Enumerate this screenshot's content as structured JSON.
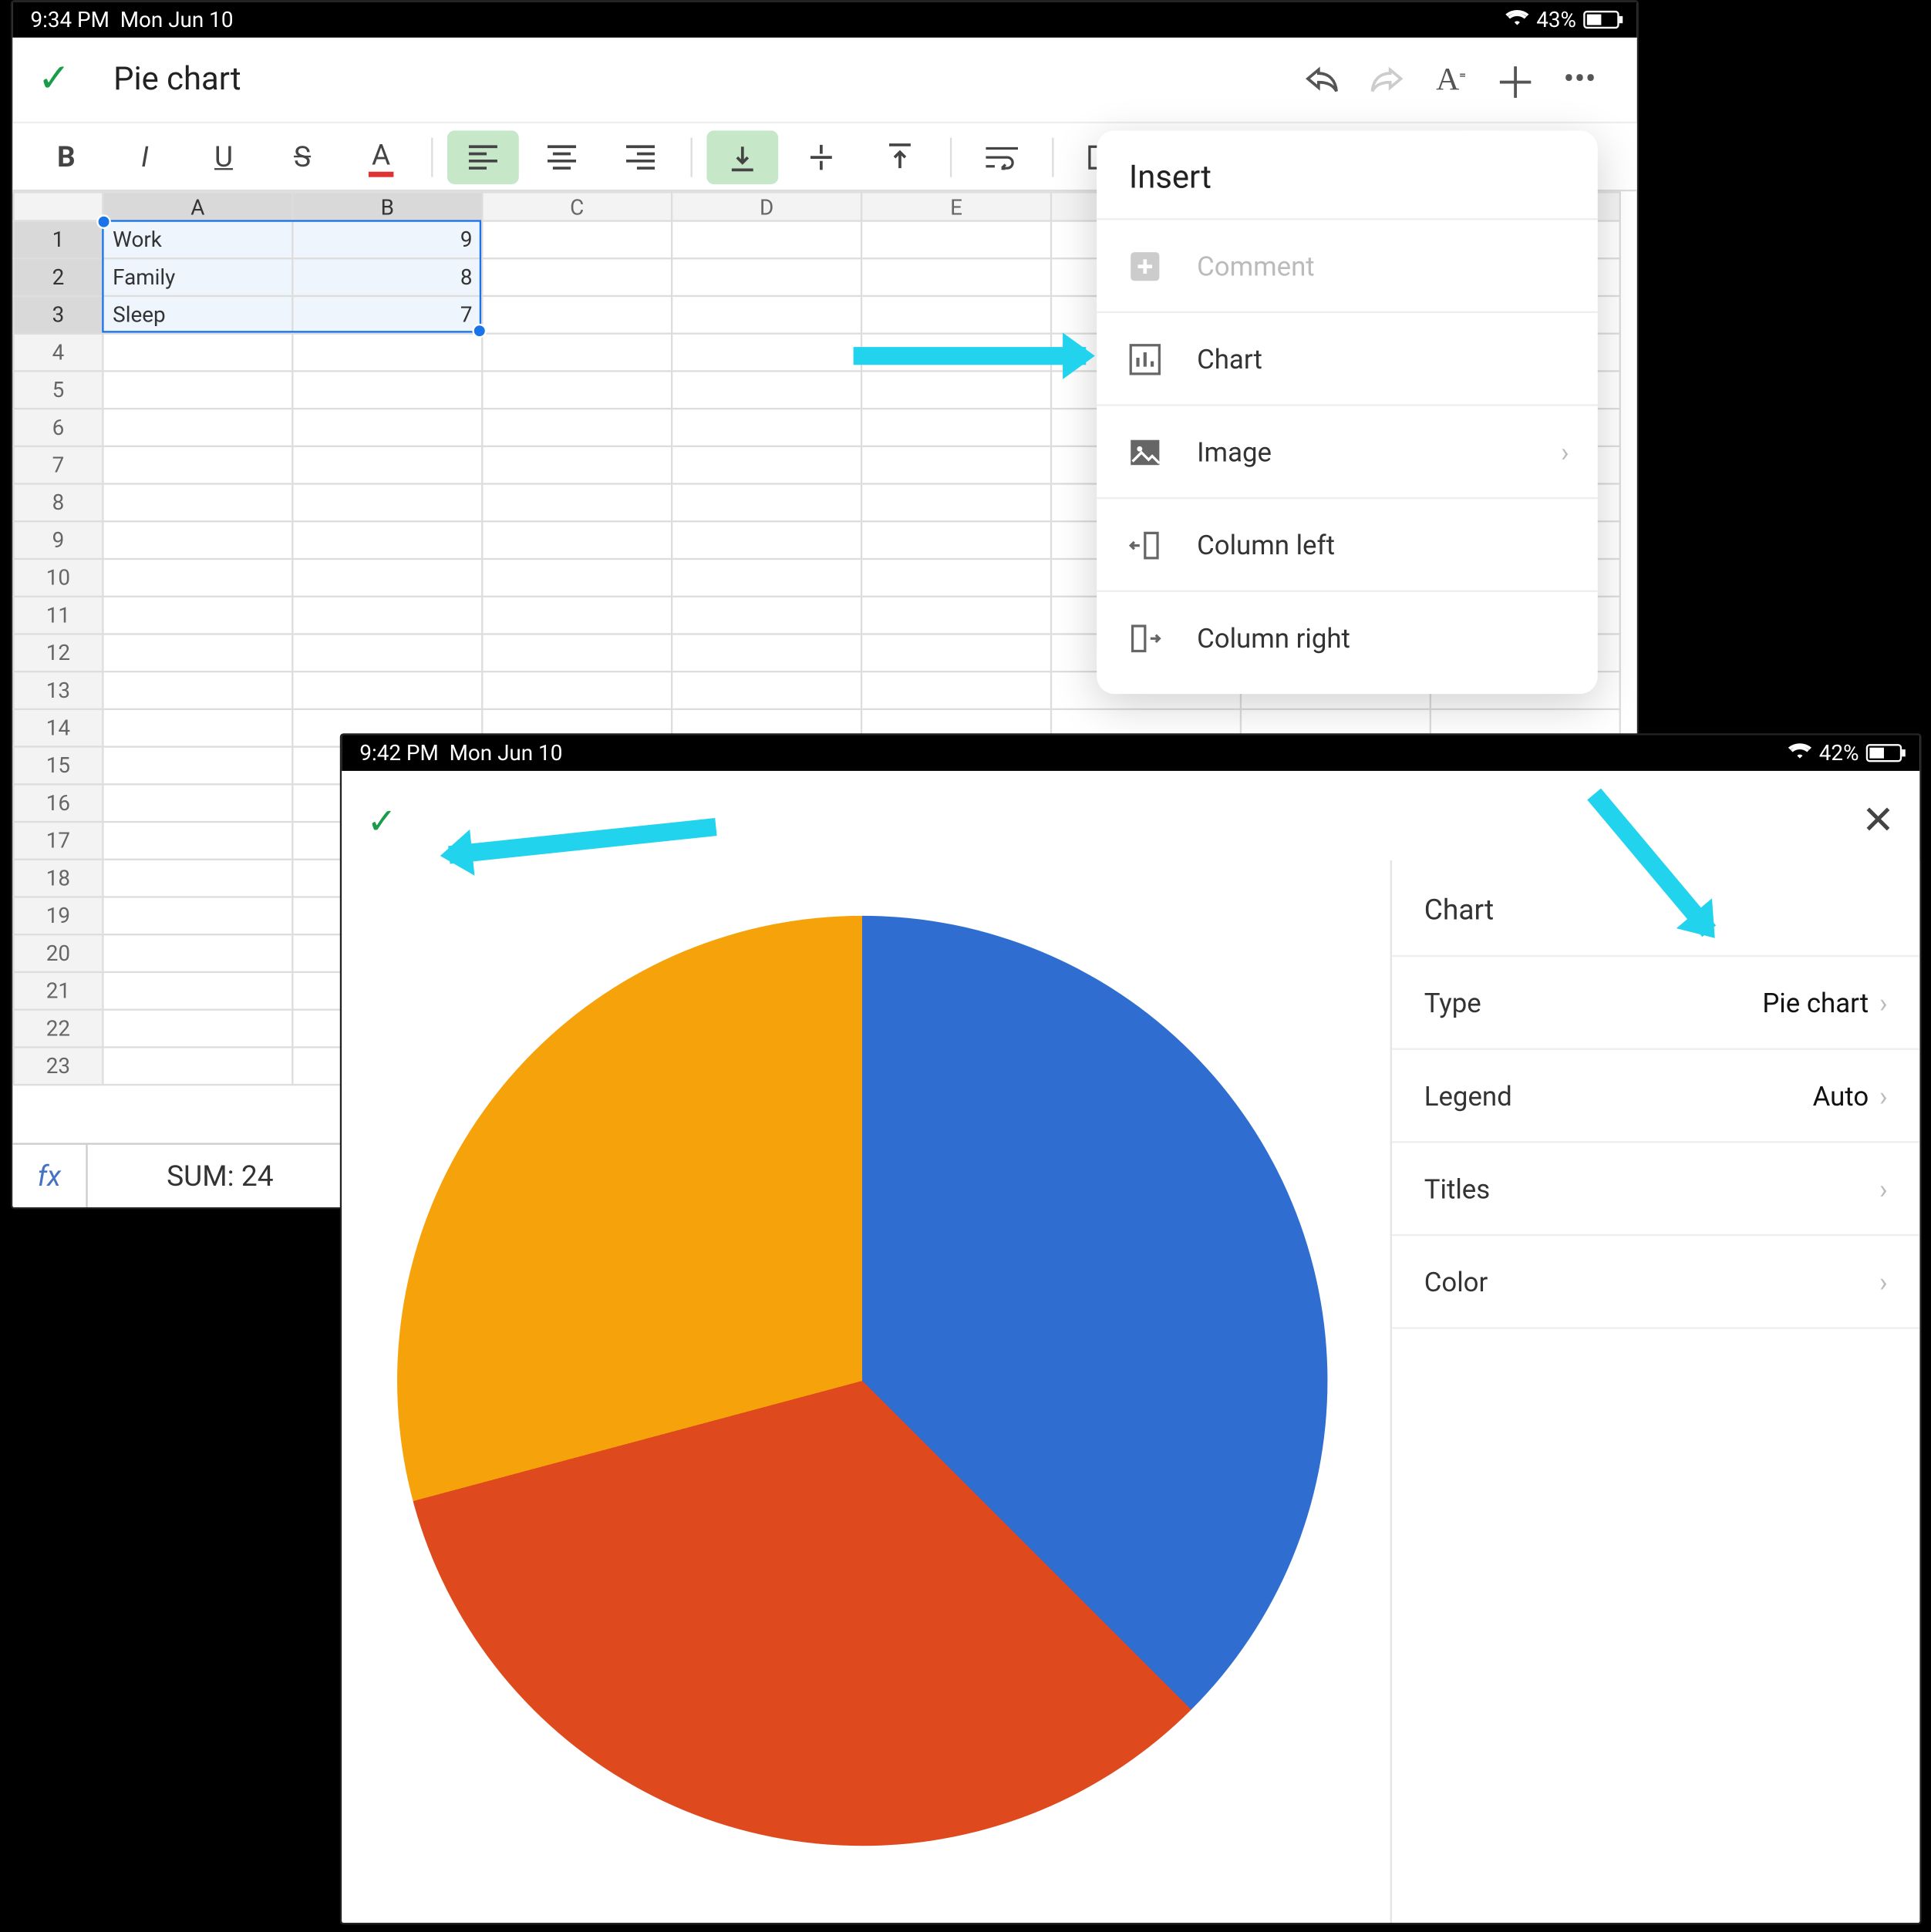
{
  "status1": {
    "time": "9:34 PM",
    "date": "Mon Jun 10",
    "battery": "43%"
  },
  "status2": {
    "time": "9:42 PM",
    "date": "Mon Jun 10",
    "battery": "42%"
  },
  "doc_title": "Pie chart",
  "columns": [
    "A",
    "B",
    "C",
    "D",
    "E"
  ],
  "rows_visible": 23,
  "cells": {
    "A1": "Work",
    "B1": "9",
    "A2": "Family",
    "B2": "8",
    "A3": "Sleep",
    "B3": "7"
  },
  "fx_label": "fx",
  "fx_sum": "SUM: 24",
  "insert_menu": {
    "title": "Insert",
    "items": [
      {
        "label": "Comment",
        "icon": "plus-square-icon",
        "disabled": true,
        "chevron": false
      },
      {
        "label": "Chart",
        "icon": "bar-chart-icon",
        "disabled": false,
        "chevron": false
      },
      {
        "label": "Image",
        "icon": "image-icon",
        "disabled": false,
        "chevron": true
      },
      {
        "label": "Column left",
        "icon": "column-left-icon",
        "disabled": false,
        "chevron": false
      },
      {
        "label": "Column right",
        "icon": "column-right-icon",
        "disabled": false,
        "chevron": false
      }
    ]
  },
  "chart_panel": {
    "title": "Chart",
    "rows": [
      {
        "label": "Type",
        "value": "Pie chart",
        "chevron": true
      },
      {
        "label": "Legend",
        "value": "Auto",
        "chevron": true
      },
      {
        "label": "Titles",
        "value": "",
        "chevron": true
      },
      {
        "label": "Color",
        "value": "",
        "chevron": true
      }
    ]
  },
  "chart_data": {
    "type": "pie",
    "categories": [
      "Work",
      "Family",
      "Sleep"
    ],
    "values": [
      9,
      8,
      7
    ],
    "colors": [
      "#2f6ed0",
      "#de4a1e",
      "#f6a20b"
    ],
    "title": "",
    "legend": "Auto"
  },
  "colors": {
    "accent_cyan": "#22d3ee",
    "green_check": "#1a9c4a",
    "sel_blue": "#1a73e8"
  }
}
